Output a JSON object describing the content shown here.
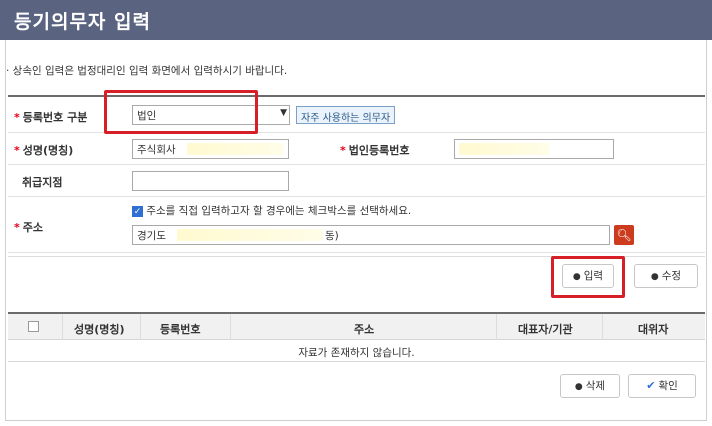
{
  "window": {
    "title": "등기의무자 입력"
  },
  "notice": "· 상속인 입력은 법정대리인 입력 화면에서 입력하시기 바랍니다.",
  "form": {
    "reg_type": {
      "label": "등록번호 구분",
      "value": "법인",
      "chip": "자주 사용하는 의무자"
    },
    "name": {
      "label": "성명(명칭)",
      "value": "주식회사"
    },
    "corp_reg": {
      "label": "법인등록번호",
      "value": ""
    },
    "branch": {
      "label": "취급지점",
      "value": ""
    },
    "address": {
      "label": "주소",
      "checkbox_label": "주소를 직접 입력하고자 할 경우에는 체크박스를 선택하세요.",
      "checked": true,
      "value_prefix": "경기도",
      "value_suffix": "동)"
    }
  },
  "actions": {
    "input": "입력",
    "edit": "수정",
    "delete": "삭제",
    "confirm": "확인"
  },
  "grid": {
    "columns": [
      "성명(명칭)",
      "등록번호",
      "주소",
      "대표자/기관",
      "대위자"
    ],
    "empty_text": "자료가 존재하지 않습니다."
  },
  "colors": {
    "titlebar": "#5a6380",
    "highlight": "#d61f26",
    "required": "#e0001b"
  },
  "icons": {
    "address_search": "search-icon",
    "input": "circle-icon",
    "confirm": "check-icon"
  }
}
